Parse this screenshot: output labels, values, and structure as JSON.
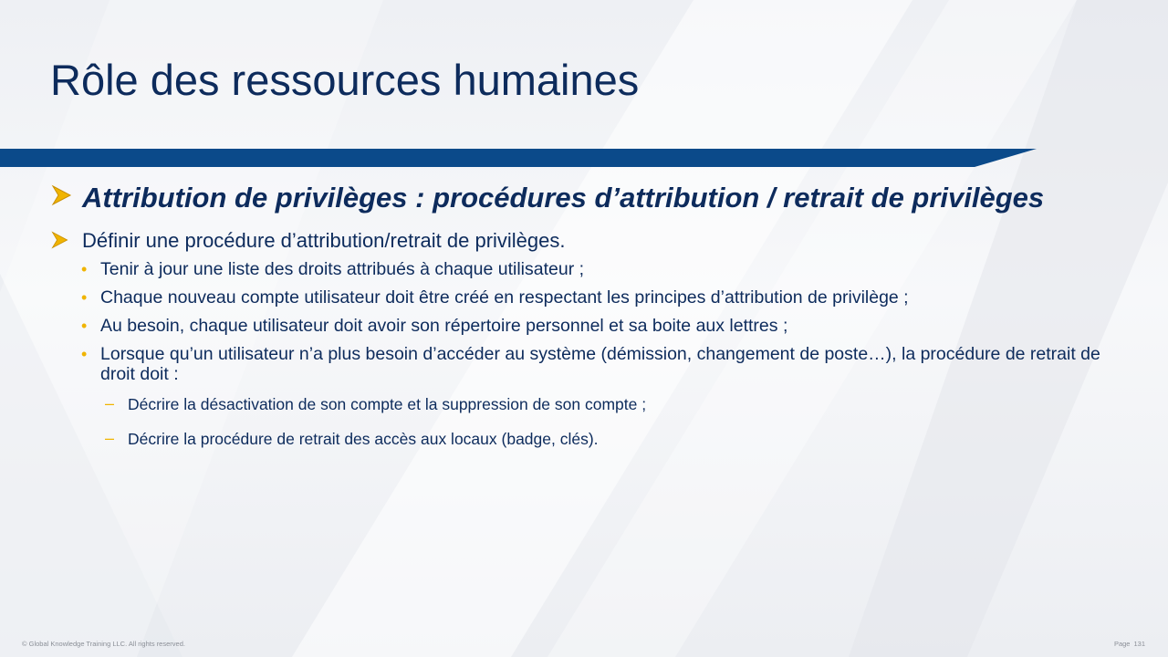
{
  "slide": {
    "title": "Rôle des ressources humaines",
    "colors": {
      "title": "#0d2b5c",
      "bar": "#0b4a8a",
      "bullet_accent": "#f0b400"
    },
    "heading": {
      "text": "Attribution de privilèges : procédures d’attribution / retrait de privilèges"
    },
    "sub_heading": {
      "text": "Définir une procédure d’attribution/retrait de privilèges."
    },
    "items": [
      {
        "text": "Tenir à jour une liste des droits attribués à chaque utilisateur ;"
      },
      {
        "text": "Chaque nouveau compte utilisateur doit être créé en respectant les principes d’attribution de privilège ;"
      },
      {
        "text": "Au besoin, chaque utilisateur doit avoir son répertoire personnel et sa boite aux lettres ;"
      },
      {
        "text": "Lorsque qu’un utilisateur n’a plus besoin d’accéder au système (démission, changement de poste…), la procédure de retrait de droit doit :"
      }
    ],
    "sub_items": [
      {
        "text": "Décrire la désactivation de son compte et la suppression de son compte ;"
      },
      {
        "text": "Décrire la procédure de retrait des accès aux locaux (badge, clés)."
      }
    ]
  },
  "footer": {
    "copyright": "© Global Knowledge  Training LLC. All rights reserved.",
    "page_label": "Page",
    "page_number": "131"
  }
}
